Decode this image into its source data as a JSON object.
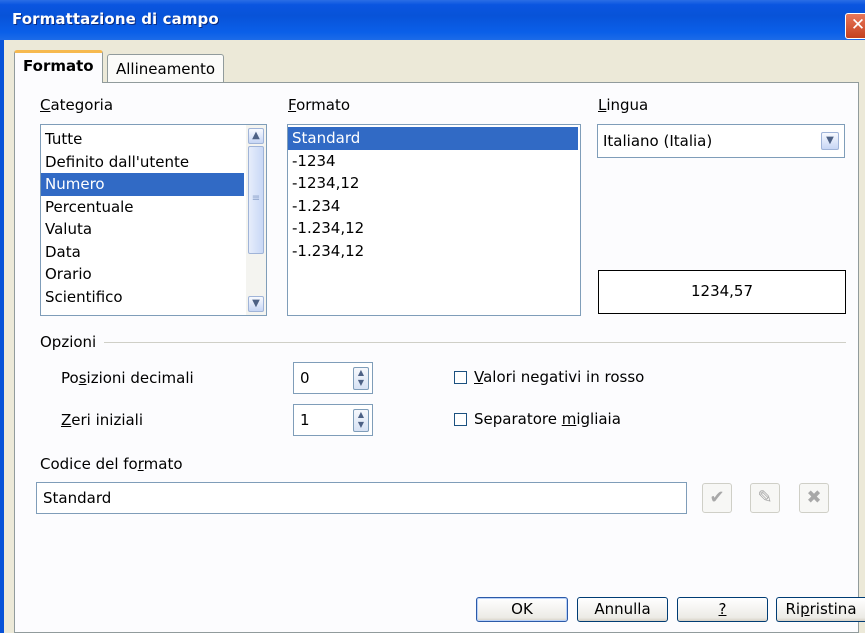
{
  "window": {
    "title": "Formattazione di campo",
    "close_label": "✕"
  },
  "tabs": [
    {
      "label": "Formato"
    },
    {
      "label": "Allineamento"
    }
  ],
  "categoria": {
    "label_u": "C",
    "label_rest": "ategoria",
    "items": [
      "Tutte",
      "Definito dall'utente",
      "Numero",
      "Percentuale",
      "Valuta",
      "Data",
      "Orario",
      "Scientifico"
    ],
    "selected": "Numero"
  },
  "formato": {
    "label_u": "F",
    "label_rest": "ormato",
    "items": [
      "Standard",
      "-1234",
      "-1234,12",
      "-1.234",
      "-1.234,12",
      "-1.234,12"
    ],
    "selected": "Standard"
  },
  "lingua": {
    "label_u": "L",
    "label_rest": "ingua",
    "value": "Italiano (Italia)"
  },
  "preview": {
    "value": "1234,57"
  },
  "opzioni": {
    "label": "Opzioni",
    "decimali": {
      "pre": "Po",
      "u": "s",
      "post": "izioni decimali",
      "value": "0"
    },
    "zeri": {
      "pre": "",
      "u": "Z",
      "post": "eri iniziali",
      "value": "1"
    },
    "negativi": {
      "u": "V",
      "post": "alori negativi in rosso",
      "checked": false
    },
    "separatore": {
      "pre": "Separatore ",
      "u": "m",
      "post": "igliaia",
      "checked": false
    }
  },
  "codice": {
    "pre": "Codice del fo",
    "u": "r",
    "post": "mato",
    "value": "Standard"
  },
  "buttons": {
    "ok": "OK",
    "annulla": "Annulla",
    "help": "?",
    "ripristina_pre": "Ri",
    "ripristina_u": "p",
    "ripristina_post": "ristina"
  },
  "icons": {
    "accept": "✔",
    "edit": "✎",
    "delete": "✖"
  },
  "colors": {
    "title_bar": "#0853d8",
    "selection": "#316ac5",
    "tab_accent": "#f6b94f"
  }
}
